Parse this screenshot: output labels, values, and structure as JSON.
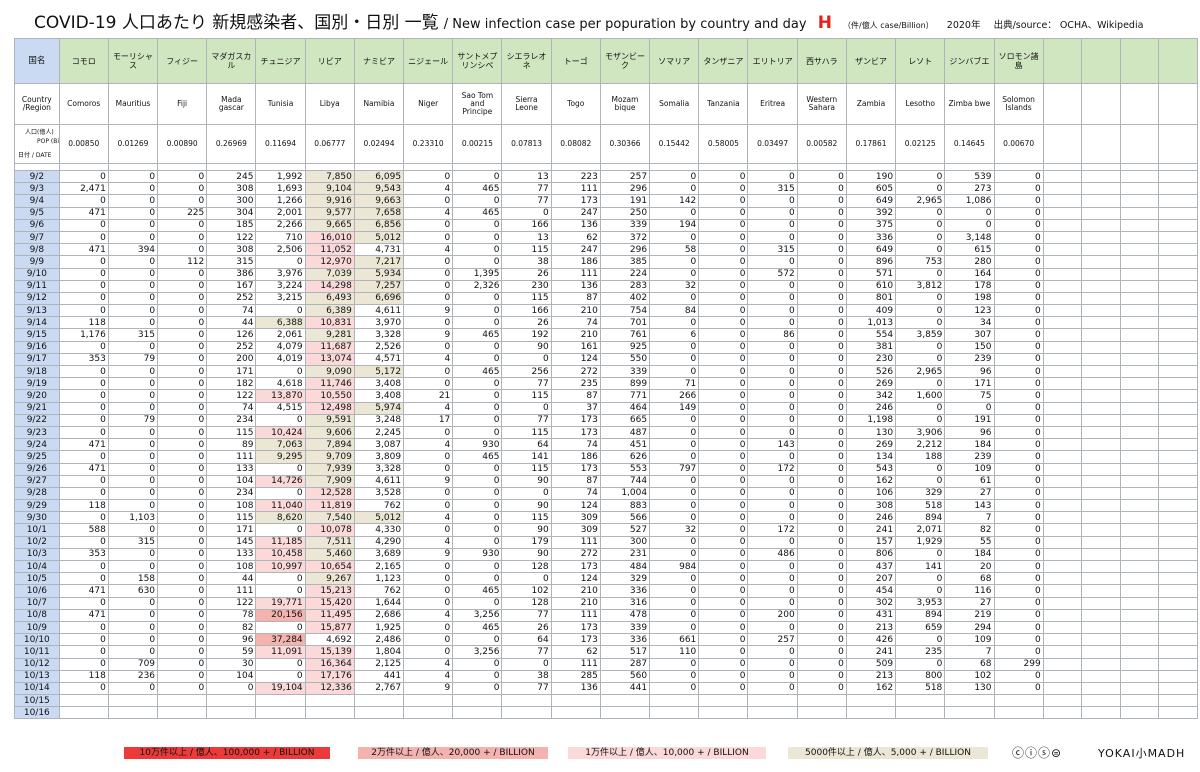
{
  "header": {
    "title_main": "COVID-19  人口あたり 新規感染者、国別・日別 一覧",
    "title_en": "/ New infection case per popuration by country and day",
    "title_mark": "H",
    "title_unit": "（件/億人 case/Billion）",
    "year": "2020年",
    "source": "出典/source： OCHA、Wikipedia"
  },
  "table_labels": {
    "jp_label": "国名",
    "en_label": "Country /Region",
    "pop_label_a": "人口(億人)",
    "pop_label_b": "POP (Billion)",
    "pop_label_c": "日付 / DATE"
  },
  "legend": {
    "l1": "10万件以上 / 億人、100,000 + / BILLION",
    "l2": "2万件以上 / 億人、20,000 + / BILLION",
    "l3": "1万件以上 / 億人、10,000 + / BILLION",
    "l4": "5000件以上 / 億人、5,000 + / BILLION",
    "cc": "ⓒⓘⓢ⊜",
    "brand": "YOKAI小MADH"
  },
  "colors": {
    "c1": "#ec3a3a",
    "c2": "#f4b3ae",
    "c3": "#fad9d8",
    "c4": "#ece7d5"
  },
  "chart_data": {
    "type": "table",
    "countries_jp": [
      "コモロ",
      "モーリシャス",
      "フィジー",
      "マダガスカル",
      "チュニジア",
      "リビア",
      "ナミビア",
      "ニジェール",
      "サントメプリンシペ",
      "シエラレオネ",
      "トーゴ",
      "モザンビーク",
      "ソマリア",
      "タンザニア",
      "エリトリア",
      "西サハラ",
      "ザンビア",
      "レソト",
      "ジンバブエ",
      "ソロモン諸島"
    ],
    "countries_en": [
      "Comoros",
      "Mauritius",
      "Fiji",
      "Mada gascar",
      "Tunisia",
      "Libya",
      "Namibia",
      "Niger",
      "Sao Tom and Principe",
      "Sierra Leone",
      "Togo",
      "Mozam bique",
      "Somalia",
      "Tanzania",
      "Eritrea",
      "Western Sahara",
      "Zambia",
      "Lesotho",
      "Zimba bwe",
      "Solomon Islands"
    ],
    "population": [
      "0.00850",
      "0.01269",
      "0.00890",
      "0.26969",
      "0.11694",
      "0.06777",
      "0.02494",
      "0.23310",
      "0.00215",
      "0.07813",
      "0.08082",
      "0.30366",
      "0.15442",
      "0.58005",
      "0.03497",
      "0.00582",
      "0.17861",
      "0.02125",
      "0.14645",
      "0.00670"
    ],
    "rows": [
      {
        "date": "9/2",
        "v": [
          "0",
          "0",
          "0",
          "245",
          "1,992",
          "7,850",
          "6,095",
          "0",
          "0",
          "13",
          "223",
          "257",
          "0",
          "0",
          "0",
          "0",
          "190",
          "0",
          "539",
          "0"
        ]
      },
      {
        "date": "9/3",
        "v": [
          "2,471",
          "0",
          "0",
          "308",
          "1,693",
          "9,104",
          "9,543",
          "4",
          "465",
          "77",
          "111",
          "296",
          "0",
          "0",
          "315",
          "0",
          "605",
          "0",
          "273",
          "0"
        ]
      },
      {
        "date": "9/4",
        "v": [
          "0",
          "0",
          "0",
          "300",
          "1,266",
          "9,916",
          "9,663",
          "0",
          "0",
          "77",
          "173",
          "191",
          "142",
          "0",
          "0",
          "0",
          "649",
          "2,965",
          "1,086",
          "0"
        ]
      },
      {
        "date": "9/5",
        "v": [
          "471",
          "0",
          "225",
          "304",
          "2,001",
          "9,577",
          "7,658",
          "4",
          "465",
          "0",
          "247",
          "250",
          "0",
          "0",
          "0",
          "0",
          "392",
          "0",
          "0",
          "0"
        ]
      },
      {
        "date": "9/6",
        "v": [
          "0",
          "0",
          "0",
          "185",
          "2,266",
          "9,665",
          "6,856",
          "0",
          "0",
          "166",
          "136",
          "339",
          "194",
          "0",
          "0",
          "0",
          "375",
          "0",
          "0",
          "0"
        ]
      },
      {
        "date": "9/7",
        "v": [
          "0",
          "0",
          "0",
          "122",
          "710",
          "16,010",
          "5,012",
          "0",
          "0",
          "13",
          "62",
          "372",
          "0",
          "0",
          "0",
          "0",
          "336",
          "0",
          "3,148",
          "0"
        ]
      },
      {
        "date": "9/8",
        "v": [
          "471",
          "394",
          "0",
          "308",
          "2,506",
          "11,052",
          "4,731",
          "4",
          "0",
          "115",
          "247",
          "296",
          "58",
          "0",
          "315",
          "0",
          "649",
          "0",
          "615",
          "0"
        ]
      },
      {
        "date": "9/9",
        "v": [
          "0",
          "0",
          "112",
          "315",
          "0",
          "12,970",
          "7,217",
          "0",
          "0",
          "38",
          "186",
          "385",
          "0",
          "0",
          "0",
          "0",
          "896",
          "753",
          "280",
          "0"
        ]
      },
      {
        "date": "9/10",
        "v": [
          "0",
          "0",
          "0",
          "386",
          "3,976",
          "7,039",
          "5,934",
          "0",
          "1,395",
          "26",
          "111",
          "224",
          "0",
          "0",
          "572",
          "0",
          "571",
          "0",
          "164",
          "0"
        ]
      },
      {
        "date": "9/11",
        "v": [
          "0",
          "0",
          "0",
          "167",
          "3,224",
          "14,298",
          "7,257",
          "0",
          "2,326",
          "230",
          "136",
          "283",
          "32",
          "0",
          "0",
          "0",
          "610",
          "3,812",
          "178",
          "0"
        ]
      },
      {
        "date": "9/12",
        "v": [
          "0",
          "0",
          "0",
          "252",
          "3,215",
          "6,493",
          "6,696",
          "0",
          "0",
          "115",
          "87",
          "402",
          "0",
          "0",
          "0",
          "0",
          "801",
          "0",
          "198",
          "0"
        ]
      },
      {
        "date": "9/13",
        "v": [
          "0",
          "0",
          "0",
          "74",
          "0",
          "6,389",
          "4,611",
          "9",
          "0",
          "166",
          "210",
          "754",
          "84",
          "0",
          "0",
          "0",
          "409",
          "0",
          "123",
          "0"
        ]
      },
      {
        "date": "9/14",
        "v": [
          "118",
          "0",
          "0",
          "44",
          "6,388",
          "10,831",
          "3,970",
          "0",
          "0",
          "26",
          "74",
          "701",
          "0",
          "0",
          "0",
          "0",
          "1,013",
          "0",
          "34",
          "0"
        ]
      },
      {
        "date": "9/15",
        "v": [
          "1,176",
          "315",
          "0",
          "126",
          "2,061",
          "9,281",
          "3,328",
          "9",
          "465",
          "192",
          "210",
          "761",
          "6",
          "0",
          "86",
          "0",
          "554",
          "3,859",
          "307",
          "0"
        ]
      },
      {
        "date": "9/16",
        "v": [
          "0",
          "0",
          "0",
          "252",
          "4,079",
          "11,687",
          "2,526",
          "0",
          "0",
          "90",
          "161",
          "925",
          "0",
          "0",
          "0",
          "0",
          "381",
          "0",
          "150",
          "0"
        ]
      },
      {
        "date": "9/17",
        "v": [
          "353",
          "79",
          "0",
          "200",
          "4,019",
          "13,074",
          "4,571",
          "4",
          "0",
          "0",
          "124",
          "550",
          "0",
          "0",
          "0",
          "0",
          "230",
          "0",
          "239",
          "0"
        ]
      },
      {
        "date": "9/18",
        "v": [
          "0",
          "0",
          "0",
          "171",
          "0",
          "9,090",
          "5,172",
          "0",
          "465",
          "256",
          "272",
          "339",
          "0",
          "0",
          "0",
          "0",
          "526",
          "2,965",
          "96",
          "0"
        ]
      },
      {
        "date": "9/19",
        "v": [
          "0",
          "0",
          "0",
          "182",
          "4,618",
          "11,746",
          "3,408",
          "0",
          "0",
          "77",
          "235",
          "899",
          "71",
          "0",
          "0",
          "0",
          "269",
          "0",
          "171",
          "0"
        ]
      },
      {
        "date": "9/20",
        "v": [
          "0",
          "0",
          "0",
          "122",
          "13,870",
          "10,550",
          "3,408",
          "21",
          "0",
          "115",
          "87",
          "771",
          "266",
          "0",
          "0",
          "0",
          "342",
          "1,600",
          "75",
          "0"
        ]
      },
      {
        "date": "9/21",
        "v": [
          "0",
          "0",
          "0",
          "74",
          "4,515",
          "12,498",
          "5,974",
          "4",
          "0",
          "0",
          "37",
          "464",
          "149",
          "0",
          "0",
          "0",
          "246",
          "0",
          "0",
          "0"
        ]
      },
      {
        "date": "9/22",
        "v": [
          "0",
          "79",
          "0",
          "234",
          "0",
          "9,591",
          "3,248",
          "17",
          "0",
          "77",
          "173",
          "665",
          "0",
          "0",
          "0",
          "0",
          "1,198",
          "0",
          "191",
          "0"
        ]
      },
      {
        "date": "9/23",
        "v": [
          "0",
          "0",
          "0",
          "115",
          "10,424",
          "9,606",
          "2,245",
          "0",
          "0",
          "115",
          "173",
          "487",
          "0",
          "0",
          "0",
          "0",
          "130",
          "3,906",
          "96",
          "0"
        ]
      },
      {
        "date": "9/24",
        "v": [
          "471",
          "0",
          "0",
          "89",
          "7,063",
          "7,894",
          "3,087",
          "4",
          "930",
          "64",
          "74",
          "451",
          "0",
          "0",
          "143",
          "0",
          "269",
          "2,212",
          "184",
          "0"
        ]
      },
      {
        "date": "9/25",
        "v": [
          "0",
          "0",
          "0",
          "111",
          "9,295",
          "9,709",
          "3,809",
          "0",
          "465",
          "141",
          "186",
          "626",
          "0",
          "0",
          "0",
          "0",
          "134",
          "188",
          "239",
          "0"
        ]
      },
      {
        "date": "9/26",
        "v": [
          "471",
          "0",
          "0",
          "133",
          "0",
          "7,939",
          "3,328",
          "0",
          "0",
          "115",
          "173",
          "553",
          "797",
          "0",
          "172",
          "0",
          "543",
          "0",
          "109",
          "0"
        ]
      },
      {
        "date": "9/27",
        "v": [
          "0",
          "0",
          "0",
          "104",
          "14,726",
          "7,909",
          "4,611",
          "9",
          "0",
          "90",
          "87",
          "744",
          "0",
          "0",
          "0",
          "0",
          "162",
          "0",
          "61",
          "0"
        ]
      },
      {
        "date": "9/28",
        "v": [
          "0",
          "0",
          "0",
          "234",
          "0",
          "12,528",
          "3,528",
          "0",
          "0",
          "0",
          "74",
          "1,004",
          "0",
          "0",
          "0",
          "0",
          "106",
          "329",
          "27",
          "0"
        ]
      },
      {
        "date": "9/29",
        "v": [
          "118",
          "0",
          "0",
          "108",
          "11,040",
          "11,819",
          "762",
          "0",
          "0",
          "90",
          "124",
          "883",
          "0",
          "0",
          "0",
          "0",
          "308",
          "518",
          "143",
          "0"
        ]
      },
      {
        "date": "9/30",
        "v": [
          "0",
          "1,103",
          "0",
          "115",
          "8,620",
          "7,540",
          "5,012",
          "4",
          "0",
          "115",
          "309",
          "566",
          "0",
          "0",
          "0",
          "0",
          "246",
          "894",
          "7",
          "0"
        ]
      },
      {
        "date": "10/1",
        "v": [
          "588",
          "0",
          "0",
          "171",
          "0",
          "10,078",
          "4,330",
          "0",
          "0",
          "90",
          "309",
          "527",
          "32",
          "0",
          "172",
          "0",
          "241",
          "2,071",
          "82",
          "0"
        ]
      },
      {
        "date": "10/2",
        "v": [
          "0",
          "315",
          "0",
          "145",
          "11,185",
          "7,511",
          "4,290",
          "4",
          "0",
          "179",
          "111",
          "300",
          "0",
          "0",
          "0",
          "0",
          "157",
          "1,929",
          "55",
          "0"
        ]
      },
      {
        "date": "10/3",
        "v": [
          "353",
          "0",
          "0",
          "133",
          "10,458",
          "5,460",
          "3,689",
          "9",
          "930",
          "90",
          "272",
          "231",
          "0",
          "0",
          "486",
          "0",
          "806",
          "0",
          "184",
          "0"
        ]
      },
      {
        "date": "10/4",
        "v": [
          "0",
          "0",
          "0",
          "108",
          "10,997",
          "10,654",
          "2,165",
          "0",
          "0",
          "128",
          "173",
          "484",
          "984",
          "0",
          "0",
          "0",
          "437",
          "141",
          "20",
          "0"
        ]
      },
      {
        "date": "10/5",
        "v": [
          "0",
          "158",
          "0",
          "44",
          "0",
          "9,267",
          "1,123",
          "0",
          "0",
          "0",
          "124",
          "329",
          "0",
          "0",
          "0",
          "0",
          "207",
          "0",
          "68",
          "0"
        ]
      },
      {
        "date": "10/6",
        "v": [
          "471",
          "630",
          "0",
          "111",
          "0",
          "15,213",
          "762",
          "0",
          "465",
          "102",
          "210",
          "336",
          "0",
          "0",
          "0",
          "0",
          "454",
          "0",
          "116",
          "0"
        ]
      },
      {
        "date": "10/7",
        "v": [
          "0",
          "0",
          "0",
          "122",
          "19,771",
          "15,420",
          "1,644",
          "0",
          "0",
          "128",
          "210",
          "316",
          "0",
          "0",
          "0",
          "0",
          "302",
          "3,953",
          "27",
          "0"
        ]
      },
      {
        "date": "10/8",
        "v": [
          "471",
          "0",
          "0",
          "78",
          "20,156",
          "11,495",
          "2,686",
          "4",
          "3,256",
          "77",
          "111",
          "478",
          "0",
          "0",
          "200",
          "0",
          "431",
          "894",
          "219",
          "0"
        ]
      },
      {
        "date": "10/9",
        "v": [
          "0",
          "0",
          "0",
          "82",
          "0",
          "15,877",
          "1,925",
          "0",
          "465",
          "26",
          "173",
          "339",
          "0",
          "0",
          "0",
          "0",
          "213",
          "659",
          "294",
          "0"
        ]
      },
      {
        "date": "10/10",
        "v": [
          "0",
          "0",
          "0",
          "96",
          "37,284",
          "4,692",
          "2,486",
          "0",
          "0",
          "64",
          "173",
          "336",
          "661",
          "0",
          "257",
          "0",
          "426",
          "0",
          "109",
          "0"
        ]
      },
      {
        "date": "10/11",
        "v": [
          "0",
          "0",
          "0",
          "59",
          "11,091",
          "15,139",
          "1,804",
          "0",
          "3,256",
          "77",
          "62",
          "517",
          "110",
          "0",
          "0",
          "0",
          "241",
          "235",
          "7",
          "0"
        ]
      },
      {
        "date": "10/12",
        "v": [
          "0",
          "709",
          "0",
          "30",
          "0",
          "16,364",
          "2,125",
          "4",
          "0",
          "0",
          "111",
          "287",
          "0",
          "0",
          "0",
          "0",
          "509",
          "0",
          "68",
          "299"
        ]
      },
      {
        "date": "10/13",
        "v": [
          "118",
          "236",
          "0",
          "104",
          "0",
          "17,176",
          "441",
          "4",
          "0",
          "38",
          "285",
          "560",
          "0",
          "0",
          "0",
          "0",
          "213",
          "800",
          "102",
          "0"
        ]
      },
      {
        "date": "10/14",
        "v": [
          "0",
          "0",
          "0",
          "0",
          "19,104",
          "12,336",
          "2,767",
          "9",
          "0",
          "77",
          "136",
          "441",
          "0",
          "0",
          "0",
          "0",
          "162",
          "518",
          "130",
          "0"
        ]
      },
      {
        "date": "10/15",
        "v": []
      },
      {
        "date": "10/16",
        "v": []
      }
    ]
  }
}
